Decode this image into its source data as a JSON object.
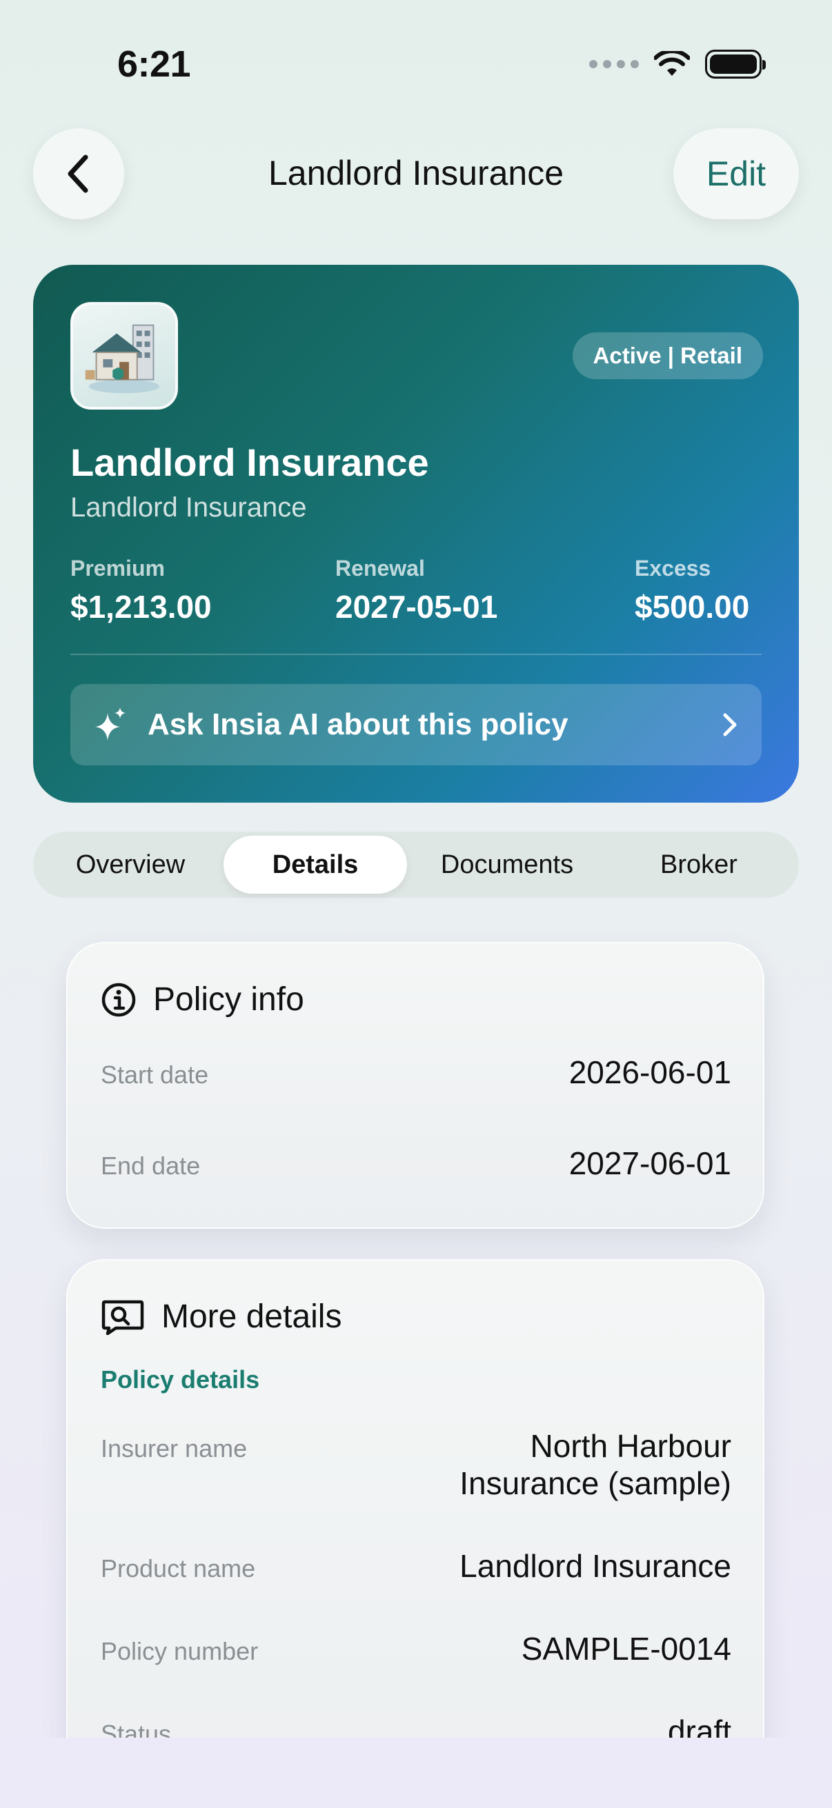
{
  "status_bar": {
    "time": "6:21"
  },
  "nav": {
    "title": "Landlord Insurance",
    "edit_label": "Edit"
  },
  "hero": {
    "badge": "Active | Retail",
    "title": "Landlord Insurance",
    "subtitle": "Landlord Insurance",
    "stats": [
      {
        "label": "Premium",
        "value": "$1,213.00"
      },
      {
        "label": "Renewal",
        "value": "2027-05-01"
      },
      {
        "label": "Excess",
        "value": "$500.00"
      }
    ],
    "ask_ai_label": "Ask Insia AI about this policy"
  },
  "tabs": [
    {
      "label": "Overview",
      "active": false
    },
    {
      "label": "Details",
      "active": true
    },
    {
      "label": "Documents",
      "active": false
    },
    {
      "label": "Broker",
      "active": false
    }
  ],
  "policy_info": {
    "title": "Policy info",
    "rows": [
      {
        "label": "Start date",
        "value": "2026-06-01"
      },
      {
        "label": "End date",
        "value": "2027-06-01"
      }
    ]
  },
  "more_details": {
    "title": "More details",
    "section": "Policy details",
    "rows": [
      {
        "label": "Insurer name",
        "value_line1": "North Harbour",
        "value_line2": "Insurance (sample)"
      },
      {
        "label": "Product name",
        "value": "Landlord Insurance"
      },
      {
        "label": "Policy number",
        "value": "SAMPLE-0014"
      },
      {
        "label": "Status",
        "value": "draft"
      }
    ]
  },
  "colors": {
    "accent": "#1c6f68",
    "section_label": "#1a7d70",
    "hero_start": "#115a52",
    "hero_end": "#3b78e0"
  },
  "icons": {
    "back": "chevron-left-icon",
    "ai": "sparkles-icon",
    "chevron": "chevron-right-icon",
    "info": "info-circle-icon",
    "details": "chat-search-icon"
  }
}
